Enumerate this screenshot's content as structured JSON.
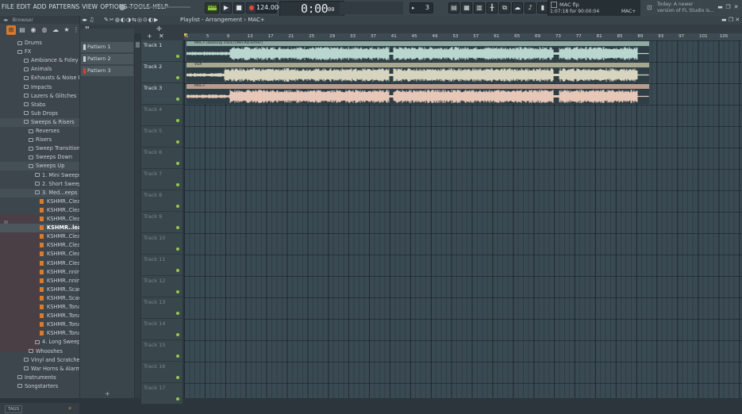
{
  "menu": [
    "FILE",
    "EDIT",
    "ADD",
    "PATTERNS",
    "VIEW",
    "OPTIONS",
    "TOOLS",
    "HELP"
  ],
  "transport": {
    "mode": "SONG",
    "tempo": "124.000",
    "time_main": "0:00",
    "time_small": "00"
  },
  "pattern_selector": {
    "value": "3"
  },
  "hint": {
    "title": "MAC flp",
    "time": "1:07:18 for 90:00:04",
    "tag": "MAC+"
  },
  "news": {
    "line1": "Today: A newer",
    "line2": "version of FL Studio is..."
  },
  "browser": {
    "title": "Browser",
    "tree": [
      {
        "label": "Drums",
        "level": 1,
        "type": "folder"
      },
      {
        "label": "FX",
        "level": 1,
        "type": "folder"
      },
      {
        "label": "Ambiance & Foley",
        "level": 2,
        "type": "folder"
      },
      {
        "label": "Animals",
        "level": 2,
        "type": "folder"
      },
      {
        "label": "Exhausts & Noise FX",
        "level": 2,
        "type": "folder"
      },
      {
        "label": "Impacts",
        "level": 2,
        "type": "folder"
      },
      {
        "label": "Lazers & Glitches",
        "level": 2,
        "type": "folder"
      },
      {
        "label": "Stabs",
        "level": 2,
        "type": "folder"
      },
      {
        "label": "Sub Drops",
        "level": 2,
        "type": "folder"
      },
      {
        "label": "Sweeps & Risers",
        "level": 2,
        "type": "folder"
      },
      {
        "label": "Reverses",
        "level": 3,
        "type": "folder"
      },
      {
        "label": "Risers",
        "level": 3,
        "type": "folder"
      },
      {
        "label": "Sweep Transitions",
        "level": 3,
        "type": "folder"
      },
      {
        "label": "Sweeps Down",
        "level": 3,
        "type": "folder"
      },
      {
        "label": "Sweeps Up",
        "level": 3,
        "type": "folder"
      },
      {
        "label": "1. Mini Sweeps",
        "level": 4,
        "type": "folder"
      },
      {
        "label": "2. Short Sweeps",
        "level": 4,
        "type": "folder"
      },
      {
        "label": "3. Med...eeps",
        "level": 4,
        "type": "folder"
      },
      {
        "label": "KSHMR..Clean",
        "level": 5,
        "type": "file"
      },
      {
        "label": "KSHMR..Clean",
        "level": 5,
        "type": "file"
      },
      {
        "label": "KSHMR..Clean",
        "level": 5,
        "type": "file"
      },
      {
        "label": "KSHMR..lean",
        "level": 5,
        "type": "file"
      },
      {
        "label": "KSHMR..Clean",
        "level": 5,
        "type": "file"
      },
      {
        "label": "KSHMR..Clean",
        "level": 5,
        "type": "file"
      },
      {
        "label": "KSHMR..Clean",
        "level": 5,
        "type": "file"
      },
      {
        "label": "KSHMR..Clean",
        "level": 5,
        "type": "file"
      },
      {
        "label": "KSHMR..nning",
        "level": 5,
        "type": "file"
      },
      {
        "label": "KSHMR..nning",
        "level": 5,
        "type": "file"
      },
      {
        "label": "KSHMR..Scary",
        "level": 5,
        "type": "file"
      },
      {
        "label": "KSHMR..Scary",
        "level": 5,
        "type": "file"
      },
      {
        "label": "KSHMR..Tonal",
        "level": 5,
        "type": "file"
      },
      {
        "label": "KSHMR..Tonal",
        "level": 5,
        "type": "file"
      },
      {
        "label": "KSHMR..Tonal",
        "level": 5,
        "type": "file"
      },
      {
        "label": "KSHMR..Tonal",
        "level": 5,
        "type": "file"
      },
      {
        "label": "4. Long Sweeps",
        "level": 4,
        "type": "folder"
      },
      {
        "label": "Whooshes",
        "level": 3,
        "type": "folder"
      },
      {
        "label": "Vinyl and Scratches",
        "level": 2,
        "type": "folder"
      },
      {
        "label": "War Horns & Alarms",
        "level": 2,
        "type": "folder"
      },
      {
        "label": "Instruments",
        "level": 1,
        "type": "folder"
      },
      {
        "label": "Songstarters",
        "level": 1,
        "type": "folder"
      }
    ],
    "selected_index": 21,
    "tags_label": "TAGS"
  },
  "patterns": [
    "Pattern 1",
    "Pattern 2",
    "Pattern 3"
  ],
  "playlist": {
    "title": "Playlist - Arrangement",
    "arrangement": "MAC+",
    "ruler": [
      "1",
      "5",
      "9",
      "13",
      "17",
      "21",
      "25",
      "29",
      "33",
      "37",
      "41",
      "45",
      "49",
      "53",
      "57",
      "61",
      "65",
      "69",
      "73",
      "77",
      "81",
      "85",
      "89",
      "93",
      "97",
      "101",
      "105"
    ],
    "tracks": [
      "Track 1",
      "Track 2",
      "Track 3",
      "Track 4",
      "Track 5",
      "Track 6",
      "Track 7",
      "Track 8",
      "Track 9",
      "Track 10",
      "Track 11",
      "Track 12",
      "Track 13",
      "Track 14",
      "Track 15",
      "Track 16",
      "Track 17"
    ],
    "clips": [
      {
        "track": 0,
        "label": "MAC+ [Backing Track] [Mel-RoFormer]",
        "color": "#b9d6cf",
        "header_color": "#8fa9a3"
      },
      {
        "track": 1,
        "label": "VOX",
        "color": "#d7d5bf",
        "header_color": "#a8a790"
      },
      {
        "track": 2,
        "label": "MAC+",
        "color": "#e6c7b8",
        "header_color": "#b89c8f"
      }
    ]
  }
}
